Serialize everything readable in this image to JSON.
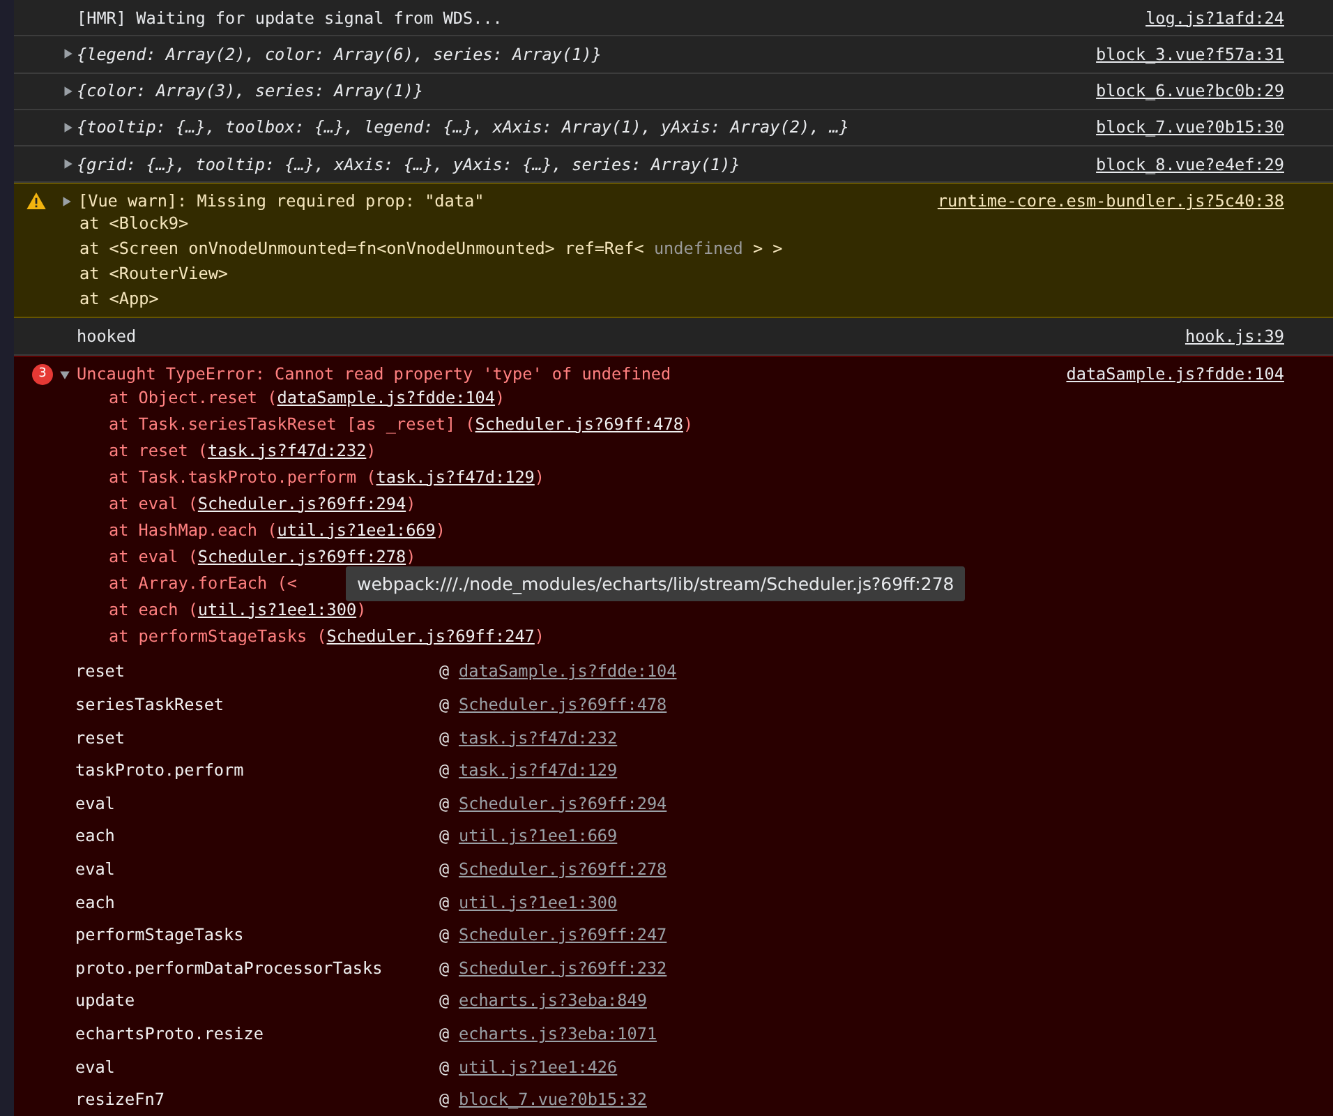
{
  "messages": [
    {
      "kind": "log",
      "text": "[HMR] Waiting for update signal from WDS...",
      "source": "log.js?1afd:24"
    },
    {
      "kind": "object",
      "expanded": false,
      "text": "{legend: Array(2), color: Array(6), series: Array(1)}",
      "source": "block_3.vue?f57a:31"
    },
    {
      "kind": "object",
      "expanded": false,
      "text": "{color: Array(3), series: Array(1)}",
      "source": "block_6.vue?bc0b:29"
    },
    {
      "kind": "object",
      "expanded": false,
      "text": "{tooltip: {…}, toolbox: {…}, legend: {…}, xAxis: Array(1), yAxis: Array(2), …}",
      "source": "block_7.vue?0b15:30"
    },
    {
      "kind": "object",
      "expanded": false,
      "text": "{grid: {…}, tooltip: {…}, xAxis: {…}, yAxis: {…}, series: Array(1)}",
      "source": "block_8.vue?e4ef:29"
    },
    {
      "kind": "warning",
      "expanded": false,
      "text": "[Vue warn]: Missing required prop: \"data\"",
      "source": "runtime-core.esm-bundler.js?5c40:38",
      "lines": [
        [
          {
            "kind": "text",
            "text": "at <Block9>"
          }
        ],
        [
          {
            "kind": "text",
            "text": "at <Screen onVnodeUnmounted=fn<onVnodeUnmounted> ref=Ref< "
          },
          {
            "kind": "muted",
            "text": "undefined"
          },
          {
            "kind": "text",
            "text": " > >"
          }
        ],
        [
          {
            "kind": "text",
            "text": "at <RouterView>"
          }
        ],
        [
          {
            "kind": "text",
            "text": "at <App>"
          }
        ]
      ]
    },
    {
      "kind": "log",
      "text": "hooked",
      "source": "hook.js:39"
    },
    {
      "kind": "error",
      "expanded": true,
      "count": "3",
      "text": "Uncaught TypeError: Cannot read property 'type' of undefined",
      "source": "dataSample.js?fdde:104",
      "lines": [
        [
          {
            "kind": "text",
            "text": "at Object.reset ("
          },
          {
            "kind": "link",
            "text": "dataSample.js?fdde:104"
          },
          {
            "kind": "text",
            "text": ")"
          }
        ],
        [
          {
            "kind": "text",
            "text": "at Task.seriesTaskReset [as _reset] ("
          },
          {
            "kind": "link",
            "text": "Scheduler.js?69ff:478"
          },
          {
            "kind": "text",
            "text": ")"
          }
        ],
        [
          {
            "kind": "text",
            "text": "at reset ("
          },
          {
            "kind": "link",
            "text": "task.js?f47d:232"
          },
          {
            "kind": "text",
            "text": ")"
          }
        ],
        [
          {
            "kind": "text",
            "text": "at Task.taskProto.perform ("
          },
          {
            "kind": "link",
            "text": "task.js?f47d:129"
          },
          {
            "kind": "text",
            "text": ")"
          }
        ],
        [
          {
            "kind": "text",
            "text": "at eval ("
          },
          {
            "kind": "link",
            "text": "Scheduler.js?69ff:294"
          },
          {
            "kind": "text",
            "text": ")"
          }
        ],
        [
          {
            "kind": "text",
            "text": "at HashMap.each ("
          },
          {
            "kind": "link",
            "text": "util.js?1ee1:669"
          },
          {
            "kind": "text",
            "text": ")"
          }
        ],
        [
          {
            "kind": "text",
            "text": "at eval ("
          },
          {
            "kind": "link",
            "text": "Scheduler.js?69ff:278"
          },
          {
            "kind": "text",
            "text": ")"
          }
        ],
        [
          {
            "kind": "text",
            "text": "at Array.forEach (<"
          },
          {
            "kind": "tooltip",
            "text": "webpack:///./node_modules/echarts/lib/stream/Scheduler.js?69ff:278"
          }
        ],
        [
          {
            "kind": "text",
            "text": "at each ("
          },
          {
            "kind": "link",
            "text": "util.js?1ee1:300"
          },
          {
            "kind": "text",
            "text": ")"
          }
        ],
        [
          {
            "kind": "text",
            "text": "at performStageTasks ("
          },
          {
            "kind": "link",
            "text": "Scheduler.js?69ff:247"
          },
          {
            "kind": "text",
            "text": ")"
          }
        ]
      ],
      "frames": [
        {
          "fn": "reset",
          "at": "@",
          "source": "dataSample.js?fdde:104"
        },
        {
          "fn": "seriesTaskReset",
          "at": "@",
          "source": "Scheduler.js?69ff:478"
        },
        {
          "fn": "reset",
          "at": "@",
          "source": "task.js?f47d:232"
        },
        {
          "fn": "taskProto.perform",
          "at": "@",
          "source": "task.js?f47d:129"
        },
        {
          "fn": "eval",
          "at": "@",
          "source": "Scheduler.js?69ff:294"
        },
        {
          "fn": "each",
          "at": "@",
          "source": "util.js?1ee1:669"
        },
        {
          "fn": "eval",
          "at": "@",
          "source": "Scheduler.js?69ff:278"
        },
        {
          "fn": "each",
          "at": "@",
          "source": "util.js?1ee1:300"
        },
        {
          "fn": "performStageTasks",
          "at": "@",
          "source": "Scheduler.js?69ff:247"
        },
        {
          "fn": "proto.performDataProcessorTasks",
          "at": "@",
          "source": "Scheduler.js?69ff:232"
        },
        {
          "fn": "update",
          "at": "@",
          "source": "echarts.js?3eba:849"
        },
        {
          "fn": "echartsProto.resize",
          "at": "@",
          "source": "echarts.js?3eba:1071"
        },
        {
          "fn": "eval",
          "at": "@",
          "source": "util.js?1ee1:426"
        },
        {
          "fn": "resizeFn7",
          "at": "@",
          "source": "block_7.vue?0b15:32"
        }
      ]
    }
  ]
}
